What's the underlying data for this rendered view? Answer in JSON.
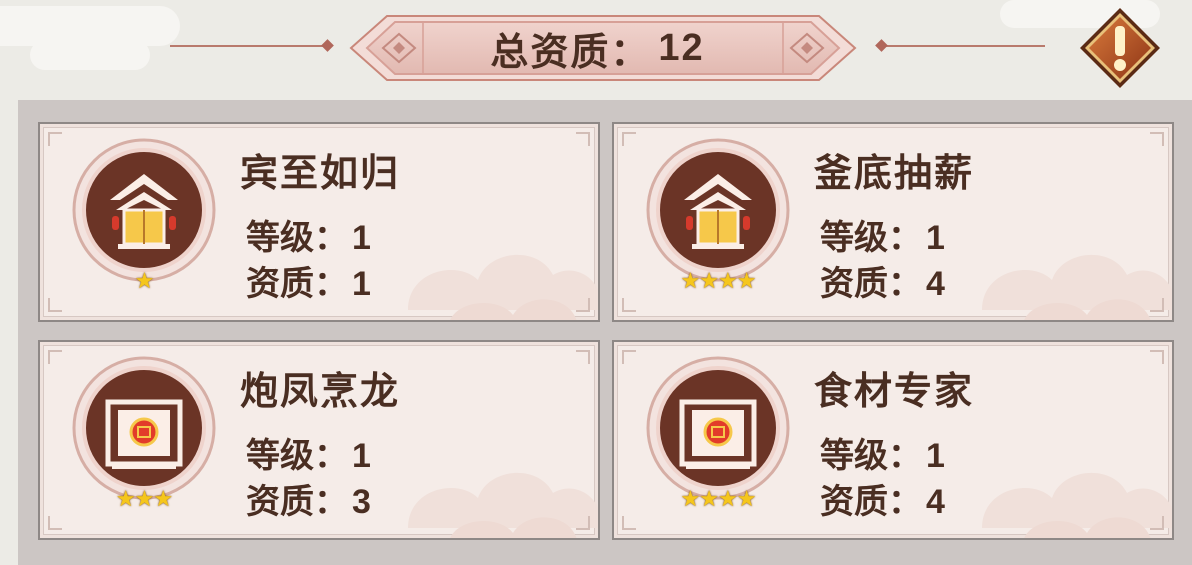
{
  "header": {
    "total_label": "总资质：",
    "total_value": "12",
    "alert_icon": "exclamation-icon"
  },
  "colors": {
    "text": "#4a2e22",
    "panel_bg": "#ccc6c4",
    "card_bg": "#f5ece8",
    "icon_brown": "#6b3426",
    "star_gold": "#f5c61c",
    "banner_pink": "#e9c6c0",
    "alert_orange": "#b8562a"
  },
  "labels": {
    "level": "等级：",
    "quality": "资质："
  },
  "cards": [
    {
      "name": "宾至如归",
      "level": "1",
      "quality": "1",
      "stars": "★",
      "icon": "pavilion-gate-icon"
    },
    {
      "name": "釜底抽薪",
      "level": "1",
      "quality": "4",
      "stars": "★★★★",
      "icon": "pavilion-gate-icon"
    },
    {
      "name": "炮凤烹龙",
      "level": "1",
      "quality": "3",
      "stars": "★★★",
      "icon": "food-cabinet-icon"
    },
    {
      "name": "食材专家",
      "level": "1",
      "quality": "4",
      "stars": "★★★★",
      "icon": "food-cabinet-icon"
    }
  ]
}
